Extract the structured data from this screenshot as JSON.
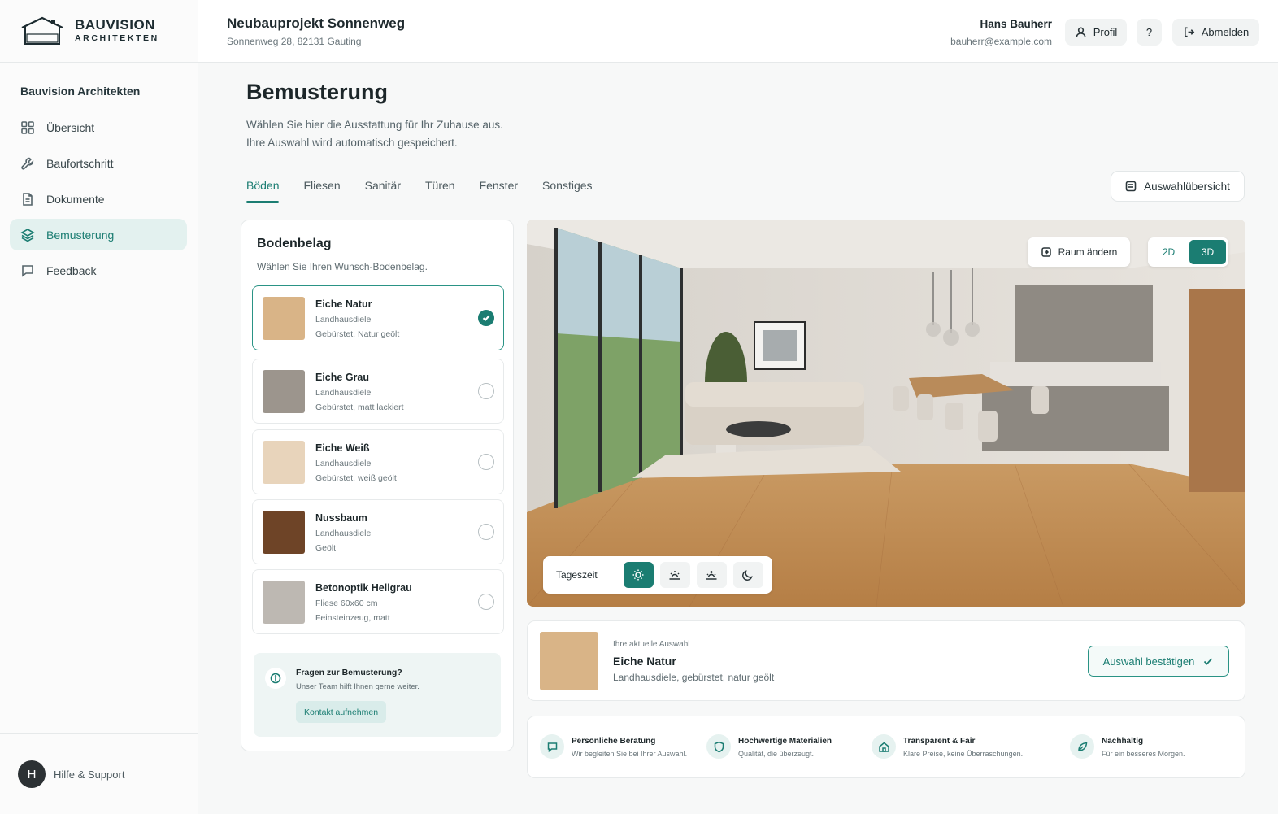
{
  "brand": {
    "name": "BAUVISION",
    "sub": "ARCHITEKTEN"
  },
  "sidebar": {
    "org": "Bauvision Architekten",
    "items": [
      {
        "label": "Übersicht",
        "icon": "grid-icon"
      },
      {
        "label": "Baufortschritt",
        "icon": "wrench-icon"
      },
      {
        "label": "Dokumente",
        "icon": "document-icon"
      },
      {
        "label": "Bemusterung",
        "icon": "layers-icon",
        "active": true
      },
      {
        "label": "Feedback",
        "icon": "message-icon"
      }
    ],
    "footer": {
      "avatar": "H",
      "label": "Hilfe & Support"
    }
  },
  "header": {
    "project_title": "Neubauprojekt Sonnenweg",
    "project_address": "Sonnenweg 28, 82131 Gauting",
    "user_name": "Hans Bauherr",
    "user_email": "bauherr@example.com",
    "profile_label": "Profil",
    "help_label": "?",
    "logout_label": "Abmelden"
  },
  "page": {
    "title": "Bemusterung",
    "subtitle_line1": "Wählen Sie hier die Ausstattung für Ihr Zuhause aus.",
    "subtitle_line2": "Ihre Auswahl wird automatisch gespeichert.",
    "tabs": [
      "Böden",
      "Fliesen",
      "Sanitär",
      "Türen",
      "Fenster",
      "Sonstiges"
    ],
    "active_tab": "Böden",
    "overview_label": "Auswahlübersicht"
  },
  "panel": {
    "title": "Bodenbelag",
    "subtitle": "Wählen Sie Ihren Wunsch-Bodenbelag.",
    "options": [
      {
        "name": "Eiche Natur",
        "line1": "Landhausdiele",
        "line2": "Gebürstet, Natur geölt",
        "color": "#d9b487",
        "selected": true
      },
      {
        "name": "Eiche Grau",
        "line1": "Landhausdiele",
        "line2": "Gebürstet, matt lackiert",
        "color": "#9c958d",
        "selected": false
      },
      {
        "name": "Eiche Weiß",
        "line1": "Landhausdiele",
        "line2": "Gebürstet, weiß geölt",
        "color": "#e8d4bb",
        "selected": false
      },
      {
        "name": "Nussbaum",
        "line1": "Landhausdiele",
        "line2": "Geölt",
        "color": "#6e4427",
        "selected": false
      },
      {
        "name": "Betonoptik Hellgrau",
        "line1": "Fliese 60x60 cm",
        "line2": "Feinsteinzeug, matt",
        "color": "#bdb8b2",
        "selected": false
      }
    ],
    "help": {
      "title": "Fragen zur Bemusterung?",
      "subtitle": "Unser Team hilft Ihnen gerne weiter.",
      "button": "Kontakt aufnehmen"
    }
  },
  "room": {
    "change_room_label": "Raum ändern",
    "view_modes": [
      "2D",
      "3D"
    ],
    "active_view": "3D",
    "time_label": "Tageszeit",
    "time_options": [
      "sun-icon",
      "sunrise-icon",
      "sunset-icon",
      "moon-icon"
    ],
    "active_time": "sun-icon"
  },
  "current_selection": {
    "label": "Ihre aktuelle Auswahl",
    "name": "Eiche Natur",
    "description": "Landhausdiele, gebürstet, natur geölt",
    "color": "#d9b487",
    "confirm_label": "Auswahl bestätigen"
  },
  "features": [
    {
      "title": "Persönliche Beratung",
      "subtitle": "Wir begleiten Sie bei Ihrer Auswahl.",
      "icon": "chat-icon"
    },
    {
      "title": "Hochwertige Materialien",
      "subtitle": "Qualität, die überzeugt.",
      "icon": "shield-icon"
    },
    {
      "title": "Transparent & Fair",
      "subtitle": "Klare Preise, keine Überraschungen.",
      "icon": "house-icon"
    },
    {
      "title": "Nachhaltig",
      "subtitle": "Für ein besseres Morgen.",
      "icon": "leaf-icon"
    }
  ]
}
